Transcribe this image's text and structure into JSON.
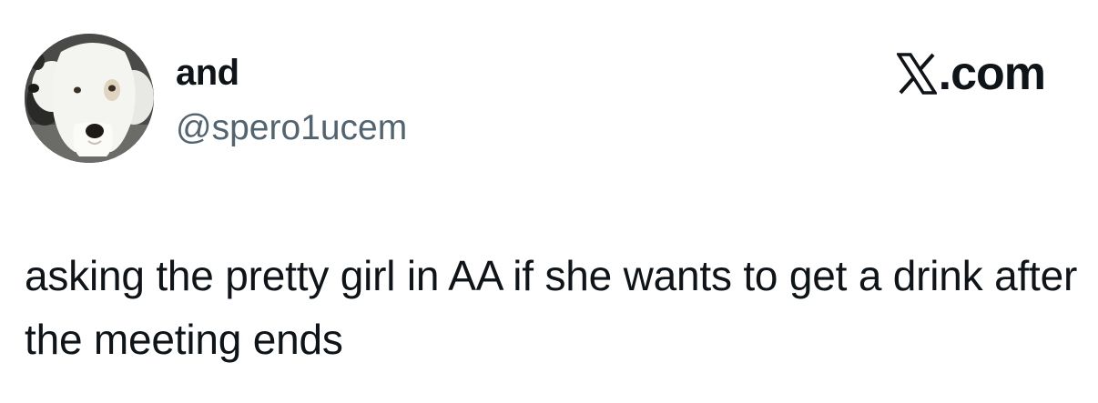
{
  "author": {
    "display_name": "and",
    "handle": "@spero1ucem",
    "avatar_icon": "dog-avatar-icon"
  },
  "brand": {
    "icon": "x-logo-icon",
    "label": ".com"
  },
  "tweet": {
    "text": "asking the pretty girl in AA if she wants to get a drink after the meeting ends"
  },
  "colors": {
    "text_primary": "#0f1419",
    "text_secondary": "#536471",
    "background": "#ffffff"
  }
}
